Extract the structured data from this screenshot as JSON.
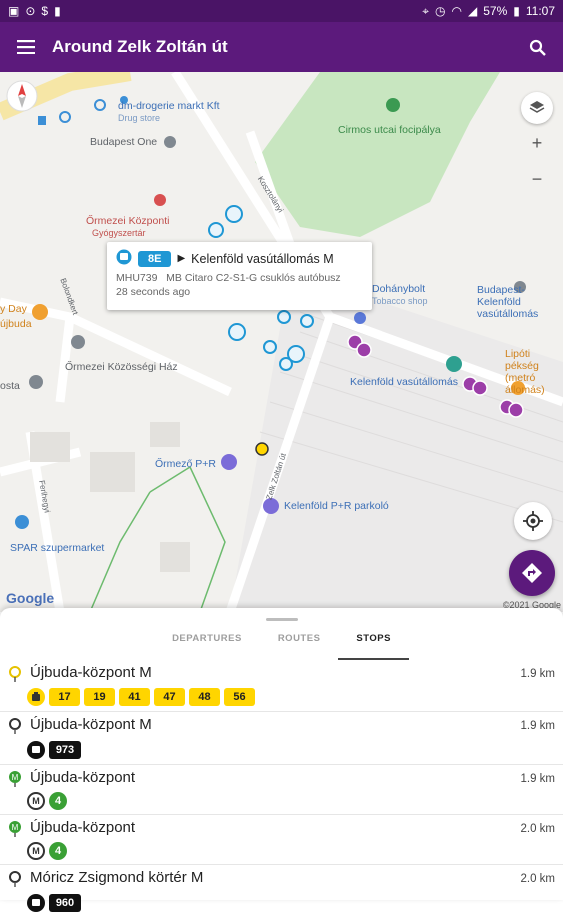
{
  "status_bar": {
    "battery": "57%",
    "time": "11:07"
  },
  "app_bar": {
    "title": "Around Zelk Zoltán út"
  },
  "map": {
    "pois": {
      "dm": "dm-drogerie markt Kft",
      "dm_sub": "Drug store",
      "budapest_one": "Budapest One",
      "cirmos": "Cirmos utcai focipálya",
      "ormezei_kozponti": "Őrmezei Központi",
      "ormezei_kozponti_sub": "Gyógyszertár",
      "kosztolanyi": "Kosztolányi",
      "dohanybolt": "Dohánybolt",
      "dohanybolt_sub": "Tobacco shop",
      "kelenfold_vasut_poi": "Budapest-Kelenföld vasútállomás",
      "lipoti": "Lipóti pékség (metró állomás)",
      "day": "y Day",
      "ujbuda_poi": "újbuda",
      "ormezei_kozossegi": "Őrmezei Közösségi Ház",
      "posta": "osta",
      "kelenfold_vasutallomas": "Kelenföld vasútállomás",
      "ormezo_pr": "Őrmező P+R",
      "kelenfold_pr": "Kelenföld P+R parkoló",
      "spar": "SPAR szupermarket",
      "zelk": "Zelk Zoltán út",
      "bolondkert": "Bolondkert",
      "ferihegyi": "Ferihegyi"
    },
    "popup": {
      "route": "8E",
      "destination": "Kelenföld vasútállomás M",
      "vehicle": "MHU739   MB Citaro C2-S1-G csuklós autóbusz",
      "age": "28 seconds ago"
    },
    "google_logo": "Google",
    "copyright": "©2021 Google"
  },
  "sheet": {
    "tabs": [
      "DEPARTURES",
      "ROUTES",
      "STOPS"
    ],
    "active_tab": "STOPS",
    "stops": [
      {
        "name": "Újbuda-központ M",
        "distance": "1.9 km",
        "mode": "tram",
        "routes": [
          "17",
          "19",
          "41",
          "47",
          "48",
          "56"
        ]
      },
      {
        "name": "Újbuda-központ M",
        "distance": "1.9 km",
        "mode": "bus",
        "routes": [
          "973"
        ]
      },
      {
        "name": "Újbuda-központ",
        "distance": "1.9 km",
        "mode": "metro",
        "routes": [
          "4"
        ]
      },
      {
        "name": "Újbuda-központ",
        "distance": "2.0 km",
        "mode": "metro",
        "routes": [
          "4"
        ]
      },
      {
        "name": "Móricz Zsigmond körtér M",
        "distance": "2.0 km",
        "mode": "bus",
        "routes": [
          "960"
        ]
      }
    ]
  },
  "colors": {
    "primary": "#5c1a7c",
    "tram_yellow": "#ffd500",
    "metro_green": "#3aa035",
    "bus_blue": "#1f97d4"
  }
}
